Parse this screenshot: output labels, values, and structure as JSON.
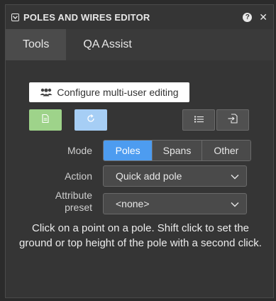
{
  "panel": {
    "title": "POLES AND WIRES EDITOR",
    "icons": {
      "collapse": "collapse-icon",
      "help": "help-icon",
      "close": "close-icon"
    },
    "help_glyph": "?",
    "close_glyph": "✕"
  },
  "tabs": [
    {
      "label": "Tools",
      "active": true
    },
    {
      "label": "QA Assist",
      "active": false
    }
  ],
  "tools": {
    "configure_label": "Configure multi-user editing",
    "buttons": [
      {
        "name": "document-icon",
        "color": "#9ed38a"
      },
      {
        "name": "refresh-icon",
        "color": "#a6cef5"
      },
      {
        "name": "list-icon",
        "color": "#505050"
      },
      {
        "name": "import-icon",
        "color": "#505050"
      }
    ]
  },
  "mode": {
    "label": "Mode",
    "options": [
      "Poles",
      "Spans",
      "Other"
    ],
    "selected": "Poles"
  },
  "action": {
    "label": "Action",
    "value": "Quick add pole"
  },
  "attribute_preset": {
    "label_line1": "Attribute",
    "label_line2": "preset",
    "value": "<none>"
  },
  "instructions": "Click on a point on a pole. Shift click to set the ground or top height of the pole with a second click.",
  "colors": {
    "accent": "#4d9cf0",
    "green": "#9ed38a",
    "blue_light": "#a6cef5"
  }
}
